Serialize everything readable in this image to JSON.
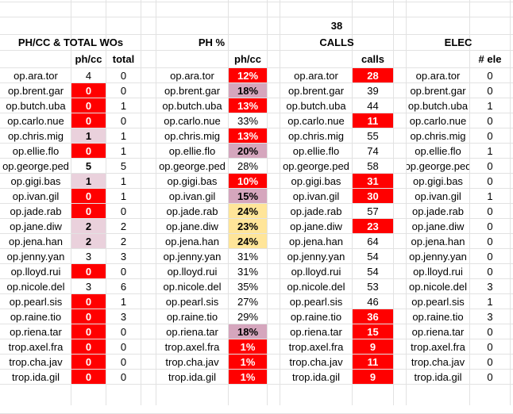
{
  "top_value": "38",
  "sections": [
    {
      "title": "PH/CC & TOTAL WOs",
      "columns": [
        "",
        "ph/cc",
        "total"
      ],
      "rows": [
        {
          "name": "op.ara.tor",
          "values": [
            "4",
            "0"
          ],
          "styles": [
            "",
            ""
          ]
        },
        {
          "name": "op.brent.gar",
          "values": [
            "0",
            "0"
          ],
          "styles": [
            "red",
            ""
          ]
        },
        {
          "name": "op.butch.uba",
          "values": [
            "0",
            "1"
          ],
          "styles": [
            "red",
            ""
          ]
        },
        {
          "name": "op.carlo.nue",
          "values": [
            "0",
            "0"
          ],
          "styles": [
            "red",
            ""
          ]
        },
        {
          "name": "op.chris.mig",
          "values": [
            "1",
            "1"
          ],
          "styles": [
            "pink",
            ""
          ]
        },
        {
          "name": "op.ellie.flo",
          "values": [
            "0",
            "1"
          ],
          "styles": [
            "red",
            ""
          ]
        },
        {
          "name": "op.george.ped",
          "values": [
            "5",
            "5"
          ],
          "styles": [
            "bold",
            ""
          ]
        },
        {
          "name": "op.gigi.bas",
          "values": [
            "1",
            "1"
          ],
          "styles": [
            "pink",
            ""
          ]
        },
        {
          "name": "op.ivan.gil",
          "values": [
            "0",
            "1"
          ],
          "styles": [
            "red",
            ""
          ]
        },
        {
          "name": "op.jade.rab",
          "values": [
            "0",
            "0"
          ],
          "styles": [
            "red",
            ""
          ]
        },
        {
          "name": "op.jane.diw",
          "values": [
            "2",
            "2"
          ],
          "styles": [
            "pink",
            ""
          ]
        },
        {
          "name": "op.jena.han",
          "values": [
            "2",
            "2"
          ],
          "styles": [
            "pink",
            ""
          ]
        },
        {
          "name": "op.jenny.yan",
          "values": [
            "3",
            "3"
          ],
          "styles": [
            "",
            ""
          ]
        },
        {
          "name": "op.lloyd.rui",
          "values": [
            "0",
            "0"
          ],
          "styles": [
            "red",
            ""
          ]
        },
        {
          "name": "op.nicole.del",
          "values": [
            "3",
            "6"
          ],
          "styles": [
            "",
            ""
          ]
        },
        {
          "name": "op.pearl.sis",
          "values": [
            "0",
            "1"
          ],
          "styles": [
            "red",
            ""
          ]
        },
        {
          "name": "op.raine.tio",
          "values": [
            "0",
            "3"
          ],
          "styles": [
            "red",
            ""
          ]
        },
        {
          "name": "op.riena.tar",
          "values": [
            "0",
            "0"
          ],
          "styles": [
            "red",
            ""
          ]
        },
        {
          "name": "trop.axel.fra",
          "values": [
            "0",
            "0"
          ],
          "styles": [
            "red",
            ""
          ]
        },
        {
          "name": "trop.cha.jav",
          "values": [
            "0",
            "0"
          ],
          "styles": [
            "red",
            ""
          ]
        },
        {
          "name": "trop.ida.gil",
          "values": [
            "0",
            "0"
          ],
          "styles": [
            "red",
            ""
          ]
        }
      ]
    },
    {
      "title": "PH %",
      "columns": [
        "",
        "ph/cc"
      ],
      "rows": [
        {
          "name": "op.ara.tor",
          "values": [
            "12%"
          ],
          "styles": [
            "red"
          ]
        },
        {
          "name": "op.brent.gar",
          "values": [
            "18%"
          ],
          "styles": [
            "mauve"
          ]
        },
        {
          "name": "op.butch.uba",
          "values": [
            "13%"
          ],
          "styles": [
            "red"
          ]
        },
        {
          "name": "op.carlo.nue",
          "values": [
            "33%"
          ],
          "styles": [
            ""
          ]
        },
        {
          "name": "op.chris.mig",
          "values": [
            "13%"
          ],
          "styles": [
            "red"
          ]
        },
        {
          "name": "op.ellie.flo",
          "values": [
            "20%"
          ],
          "styles": [
            "mauve"
          ]
        },
        {
          "name": "op.george.ped",
          "values": [
            "28%"
          ],
          "styles": [
            ""
          ]
        },
        {
          "name": "op.gigi.bas",
          "values": [
            "10%"
          ],
          "styles": [
            "red"
          ]
        },
        {
          "name": "op.ivan.gil",
          "values": [
            "15%"
          ],
          "styles": [
            "mauve"
          ]
        },
        {
          "name": "op.jade.rab",
          "values": [
            "24%"
          ],
          "styles": [
            "yellow"
          ]
        },
        {
          "name": "op.jane.diw",
          "values": [
            "23%"
          ],
          "styles": [
            "yellow"
          ]
        },
        {
          "name": "op.jena.han",
          "values": [
            "24%"
          ],
          "styles": [
            "yellow"
          ]
        },
        {
          "name": "op.jenny.yan",
          "values": [
            "31%"
          ],
          "styles": [
            ""
          ]
        },
        {
          "name": "op.lloyd.rui",
          "values": [
            "31%"
          ],
          "styles": [
            ""
          ]
        },
        {
          "name": "op.nicole.del",
          "values": [
            "35%"
          ],
          "styles": [
            ""
          ]
        },
        {
          "name": "op.pearl.sis",
          "values": [
            "27%"
          ],
          "styles": [
            ""
          ]
        },
        {
          "name": "op.raine.tio",
          "values": [
            "29%"
          ],
          "styles": [
            ""
          ]
        },
        {
          "name": "op.riena.tar",
          "values": [
            "18%"
          ],
          "styles": [
            "mauve"
          ]
        },
        {
          "name": "trop.axel.fra",
          "values": [
            "1%"
          ],
          "styles": [
            "red"
          ]
        },
        {
          "name": "trop.cha.jav",
          "values": [
            "1%"
          ],
          "styles": [
            "red"
          ]
        },
        {
          "name": "trop.ida.gil",
          "values": [
            "1%"
          ],
          "styles": [
            "red"
          ]
        }
      ]
    },
    {
      "title": "CALLS",
      "columns": [
        "",
        "calls"
      ],
      "rows": [
        {
          "name": "op.ara.tor",
          "values": [
            "28"
          ],
          "styles": [
            "red"
          ]
        },
        {
          "name": "op.brent.gar",
          "values": [
            "39"
          ],
          "styles": [
            ""
          ]
        },
        {
          "name": "op.butch.uba",
          "values": [
            "44"
          ],
          "styles": [
            ""
          ]
        },
        {
          "name": "op.carlo.nue",
          "values": [
            "11"
          ],
          "styles": [
            "red"
          ]
        },
        {
          "name": "op.chris.mig",
          "values": [
            "55"
          ],
          "styles": [
            ""
          ]
        },
        {
          "name": "op.ellie.flo",
          "values": [
            "74"
          ],
          "styles": [
            ""
          ]
        },
        {
          "name": "op.george.ped",
          "values": [
            "58"
          ],
          "styles": [
            ""
          ]
        },
        {
          "name": "op.gigi.bas",
          "values": [
            "31"
          ],
          "styles": [
            "red"
          ]
        },
        {
          "name": "op.ivan.gil",
          "values": [
            "30"
          ],
          "styles": [
            "red"
          ]
        },
        {
          "name": "op.jade.rab",
          "values": [
            "57"
          ],
          "styles": [
            ""
          ]
        },
        {
          "name": "op.jane.diw",
          "values": [
            "23"
          ],
          "styles": [
            "red"
          ]
        },
        {
          "name": "op.jena.han",
          "values": [
            "64"
          ],
          "styles": [
            ""
          ]
        },
        {
          "name": "op.jenny.yan",
          "values": [
            "54"
          ],
          "styles": [
            ""
          ]
        },
        {
          "name": "op.lloyd.rui",
          "values": [
            "54"
          ],
          "styles": [
            ""
          ]
        },
        {
          "name": "op.nicole.del",
          "values": [
            "53"
          ],
          "styles": [
            ""
          ]
        },
        {
          "name": "op.pearl.sis",
          "values": [
            "46"
          ],
          "styles": [
            ""
          ]
        },
        {
          "name": "op.raine.tio",
          "values": [
            "36"
          ],
          "styles": [
            "red"
          ]
        },
        {
          "name": "op.riena.tar",
          "values": [
            "15"
          ],
          "styles": [
            "red"
          ]
        },
        {
          "name": "trop.axel.fra",
          "values": [
            "9"
          ],
          "styles": [
            "red"
          ]
        },
        {
          "name": "trop.cha.jav",
          "values": [
            "11"
          ],
          "styles": [
            "red"
          ]
        },
        {
          "name": "trop.ida.gil",
          "values": [
            "9"
          ],
          "styles": [
            "red"
          ]
        }
      ]
    },
    {
      "title": "ELEC",
      "columns": [
        "",
        "# ele"
      ],
      "rows": [
        {
          "name": "op.ara.tor",
          "values": [
            "0"
          ],
          "styles": [
            ""
          ]
        },
        {
          "name": "op.brent.gar",
          "values": [
            "0"
          ],
          "styles": [
            ""
          ]
        },
        {
          "name": "op.butch.uba",
          "values": [
            "1"
          ],
          "styles": [
            ""
          ]
        },
        {
          "name": "op.carlo.nue",
          "values": [
            "0"
          ],
          "styles": [
            ""
          ]
        },
        {
          "name": "op.chris.mig",
          "values": [
            "0"
          ],
          "styles": [
            ""
          ]
        },
        {
          "name": "op.ellie.flo",
          "values": [
            "1"
          ],
          "styles": [
            ""
          ]
        },
        {
          "name": "op.george.ped",
          "values": [
            "0"
          ],
          "styles": [
            ""
          ]
        },
        {
          "name": "op.gigi.bas",
          "values": [
            "0"
          ],
          "styles": [
            ""
          ]
        },
        {
          "name": "op.ivan.gil",
          "values": [
            "1"
          ],
          "styles": [
            ""
          ]
        },
        {
          "name": "op.jade.rab",
          "values": [
            "0"
          ],
          "styles": [
            ""
          ]
        },
        {
          "name": "op.jane.diw",
          "values": [
            "0"
          ],
          "styles": [
            ""
          ]
        },
        {
          "name": "op.jena.han",
          "values": [
            "0"
          ],
          "styles": [
            ""
          ]
        },
        {
          "name": "op.jenny.yan",
          "values": [
            "0"
          ],
          "styles": [
            ""
          ]
        },
        {
          "name": "op.lloyd.rui",
          "values": [
            "0"
          ],
          "styles": [
            ""
          ]
        },
        {
          "name": "op.nicole.del",
          "values": [
            "3"
          ],
          "styles": [
            ""
          ]
        },
        {
          "name": "op.pearl.sis",
          "values": [
            "1"
          ],
          "styles": [
            ""
          ]
        },
        {
          "name": "op.raine.tio",
          "values": [
            "3"
          ],
          "styles": [
            ""
          ]
        },
        {
          "name": "op.riena.tar",
          "values": [
            "0"
          ],
          "styles": [
            ""
          ]
        },
        {
          "name": "trop.axel.fra",
          "values": [
            "0"
          ],
          "styles": [
            ""
          ]
        },
        {
          "name": "trop.cha.jav",
          "values": [
            "0"
          ],
          "styles": [
            ""
          ]
        },
        {
          "name": "trop.ida.gil",
          "values": [
            "0"
          ],
          "styles": [
            ""
          ]
        }
      ]
    }
  ]
}
